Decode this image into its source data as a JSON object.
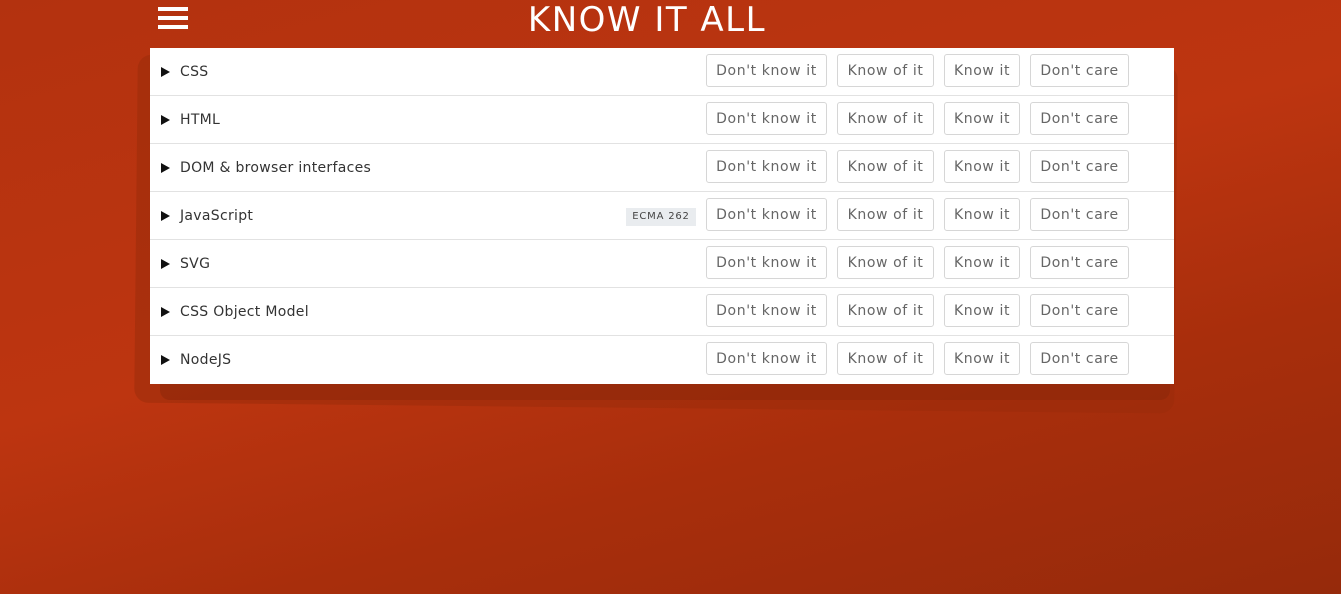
{
  "app": {
    "title": "KNOW IT ALL",
    "accent_color": "#b3320f",
    "menu_icon": "hamburger-menu-icon"
  },
  "options": [
    "Don't know it",
    "Know of it",
    "Know it",
    "Don't care"
  ],
  "topics": [
    {
      "label": "CSS",
      "badge": null
    },
    {
      "label": "HTML",
      "badge": null
    },
    {
      "label": "DOM & browser interfaces",
      "badge": null
    },
    {
      "label": "JavaScript",
      "badge": "ECMA 262"
    },
    {
      "label": "SVG",
      "badge": null
    },
    {
      "label": "CSS Object Model",
      "badge": null
    },
    {
      "label": "NodeJS",
      "badge": null
    }
  ]
}
